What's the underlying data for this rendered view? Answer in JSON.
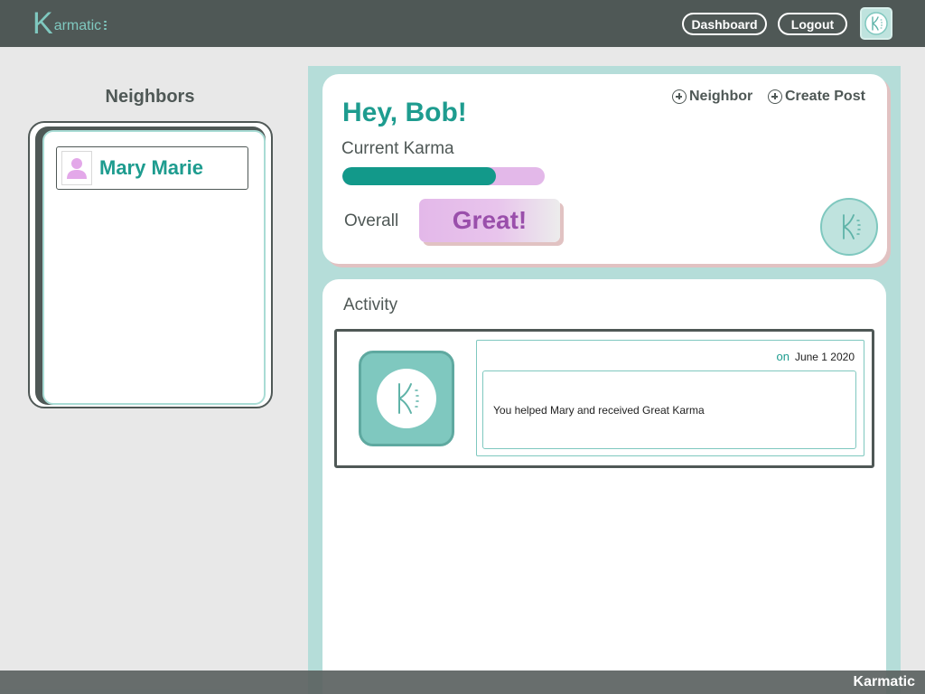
{
  "app": {
    "logo_k": "K",
    "logo_text": "armatic"
  },
  "nav": {
    "dashboard": "Dashboard",
    "logout": "Logout",
    "avatar_icon": "karmatic-logo-icon"
  },
  "neighbors": {
    "title": "Neighbors",
    "items": [
      {
        "name": "Mary Marie",
        "icon": "person-icon"
      }
    ]
  },
  "karma": {
    "greeting": "Hey, Bob!",
    "add_neighbor": "Neighbor",
    "create_post": "Create Post",
    "label": "Current Karma",
    "progress": 0.76,
    "overall_label": "Overall",
    "overall_value": "Great!"
  },
  "activity": {
    "title": "Activity",
    "items": [
      {
        "on": "on",
        "date": "June 1 2020",
        "message": "You helped Mary and received Great Karma"
      }
    ]
  },
  "footer": {
    "brand": "Karmatic"
  },
  "colors": {
    "teal": "#1e9c8f",
    "dark": "#4f5856",
    "mint": "#b5ddd9",
    "lavender": "#e3b8e9",
    "purple": "#9a4fab"
  }
}
